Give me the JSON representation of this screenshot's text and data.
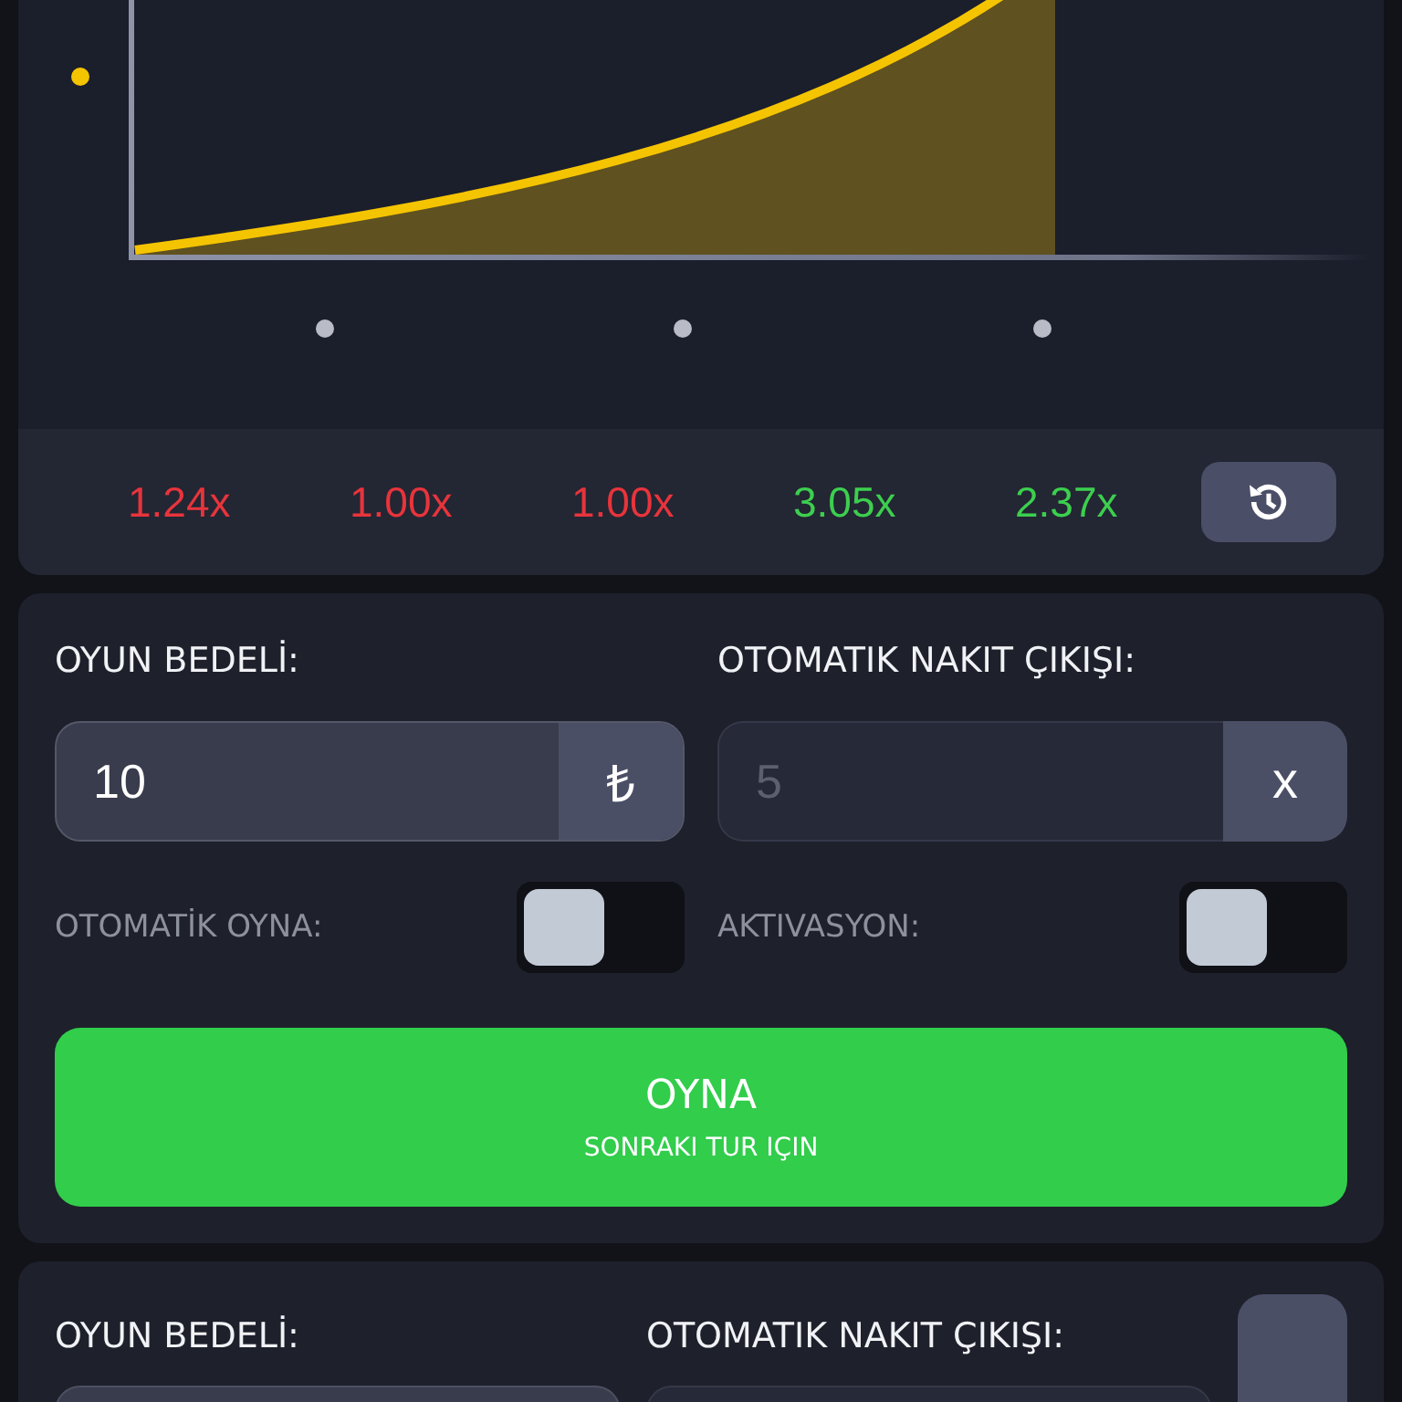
{
  "history": [
    {
      "value": "1.24x",
      "color": "#e8343c"
    },
    {
      "value": "1.00x",
      "color": "#e8343c"
    },
    {
      "value": "1.00x",
      "color": "#e8343c"
    },
    {
      "value": "3.05x",
      "color": "#3ccf4e"
    },
    {
      "value": "2.37x",
      "color": "#3ccf4e"
    }
  ],
  "bet_panel": {
    "bet_label": "OYUN BEDELİ:",
    "bet_value": "10",
    "currency": "₺",
    "cashout_label": "OTOMATIK NAKIT ÇIKIŞI:",
    "cashout_placeholder": "5",
    "cashout_suffix": "x",
    "toggles": [
      {
        "label": "OTOMATİK OYNA:",
        "on": false
      },
      {
        "label": "AKTIVASYON:",
        "on": false
      }
    ],
    "play_button": {
      "title": "OYNA",
      "subtitle": "SONRAKI TUR IÇIN"
    }
  },
  "second_panel": {
    "bet_label": "OYUN BEDELİ:",
    "cashout_label": "OTOMATIK NAKIT ÇIKIŞI:"
  }
}
